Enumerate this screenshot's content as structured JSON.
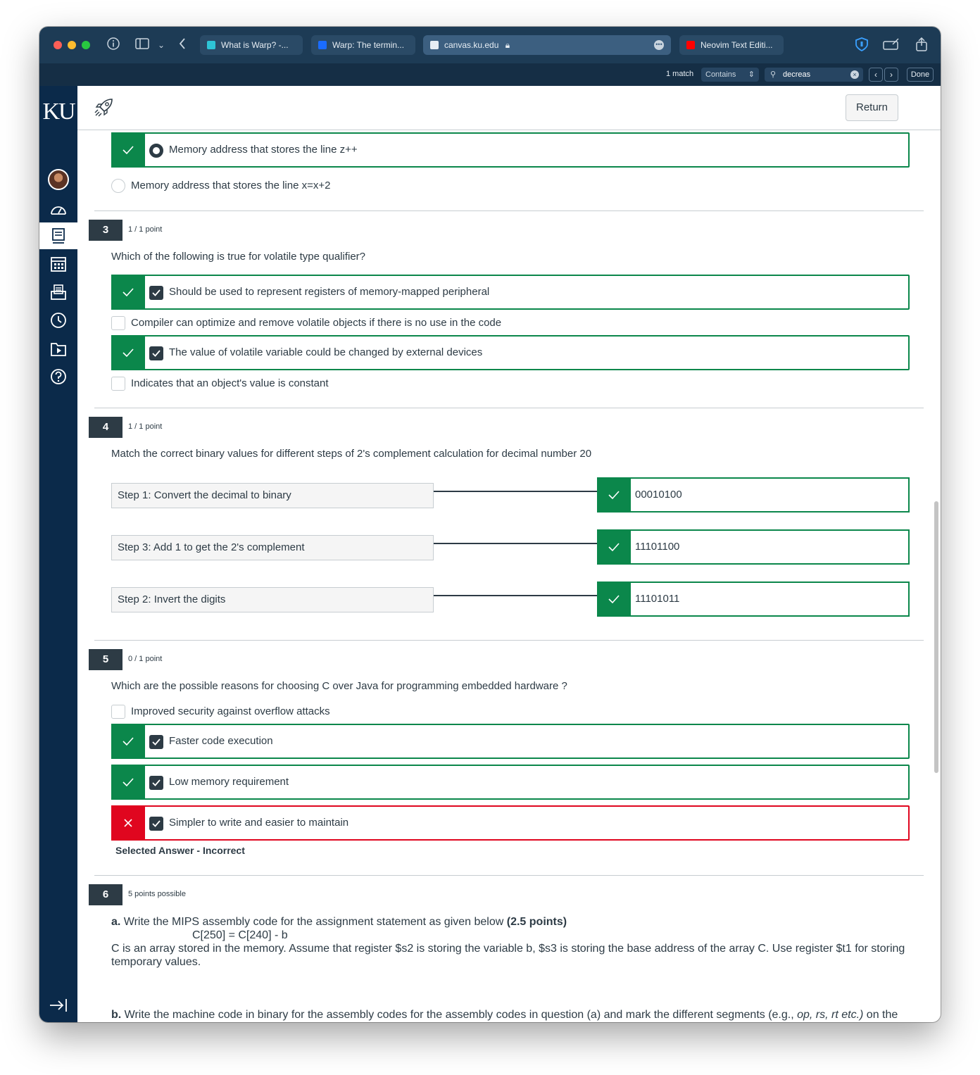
{
  "browser": {
    "tabs": [
      {
        "title": "What is Warp? -...",
        "color": "#2ec4d6"
      },
      {
        "title": "Warp: The termin...",
        "color": "#1a6cff"
      },
      {
        "title": "canvas.ku.edu",
        "color": "#e6edf3",
        "active": true
      },
      {
        "title": "Neovim Text Editi...",
        "color": "#ff0000"
      }
    ],
    "find": {
      "match": "1 match",
      "mode": "Contains",
      "query": "decreas",
      "done": "Done"
    }
  },
  "nav": {
    "logo": "KU"
  },
  "header": {
    "return_label": "Return"
  },
  "q2": {
    "answers": [
      {
        "label": "Memory address that stores the line z++",
        "selected": true,
        "correct": true
      },
      {
        "label": "Memory address that stores the line x=x+2",
        "selected": false
      }
    ]
  },
  "q3": {
    "number": "3",
    "points": "1 / 1 point",
    "text": "Which of the following is true for volatile type qualifier?",
    "answers": [
      {
        "label": "Should be used to represent registers of memory-mapped peripheral",
        "selected": true,
        "correct": true
      },
      {
        "label": "Compiler can optimize and remove volatile objects if there is no use in the code",
        "selected": false
      },
      {
        "label": "The value of volatile variable could be changed by external devices",
        "selected": true,
        "correct": true
      },
      {
        "label": "Indicates that an object's value is constant",
        "selected": false
      }
    ]
  },
  "q4": {
    "number": "4",
    "points": "1 / 1 point",
    "text": "Match the correct binary values for different steps of 2's complement calculation for decimal number 20",
    "pairs": [
      {
        "step": "Step 1: Convert the decimal to binary",
        "value": "00010100"
      },
      {
        "step": "Step 3: Add 1 to get the 2's complement",
        "value": "11101100"
      },
      {
        "step": "Step 2: Invert the digits",
        "value": "11101011"
      }
    ]
  },
  "q5": {
    "number": "5",
    "points": "0 / 1 point",
    "text": "Which are the possible reasons for choosing C over Java for programming embedded hardware ?",
    "answers": [
      {
        "label": "Improved security against overflow attacks",
        "selected": false
      },
      {
        "label": "Faster code execution",
        "selected": true,
        "correct": true
      },
      {
        "label": "Low memory requirement",
        "selected": true,
        "correct": true
      },
      {
        "label": "Simpler to write and easier to maintain",
        "selected": true,
        "correct": false
      }
    ],
    "feedback": "Selected Answer - Incorrect"
  },
  "q6": {
    "number": "6",
    "points": "5 points possible",
    "a_prefix": "a.",
    "a_text": " Write the MIPS assembly code for the assignment statement as given below ",
    "a_points": "(2.5 points)",
    "statement": "C[250] = C[240] - b",
    "desc": "C is an array stored in the memory. Assume that register $s2 is storing the variable b, $s3 is storing the base address of the array C. Use register $t1 for storing temporary values.",
    "b_prefix": "b.",
    "b_text": " Write the machine code in binary for the assembly codes for the assembly codes in question (a) and mark the different segments (e.g., ",
    "b_italic": "op, rs, rt etc.)",
    "b_tail": " on the"
  },
  "colors": {
    "correct": "#0b874b",
    "incorrect": "#e0061f",
    "nav": "#0b2a4a",
    "titlebar": "#1d3b55"
  }
}
